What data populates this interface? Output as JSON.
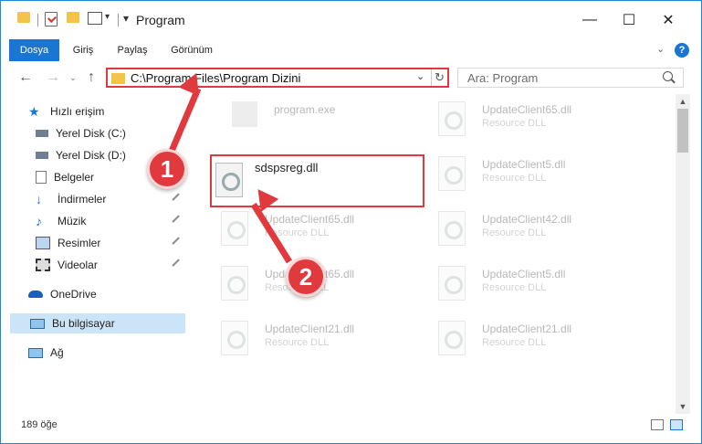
{
  "window": {
    "title": "Program"
  },
  "ribbon": {
    "tabs": [
      "Dosya",
      "Giriş",
      "Paylaş",
      "Görünüm"
    ]
  },
  "address": {
    "path": "C:\\Program Files\\Program Dizini"
  },
  "search": {
    "placeholder": "Ara: Program"
  },
  "sidebar": {
    "items": [
      {
        "label": "Hızlı erişim"
      },
      {
        "label": "Yerel Disk (C:)"
      },
      {
        "label": "Yerel Disk (D:)"
      },
      {
        "label": "Belgeler"
      },
      {
        "label": "İndirmeler"
      },
      {
        "label": "Müzik"
      },
      {
        "label": "Resimler"
      },
      {
        "label": "Videolar"
      },
      {
        "label": "OneDrive"
      },
      {
        "label": "Bu bilgisayar"
      },
      {
        "label": "Ağ"
      }
    ]
  },
  "files": [
    {
      "name": "program.exe",
      "desc": ""
    },
    {
      "name": "UpdateClient65.dll",
      "desc": "Resource DLL"
    },
    {
      "name": "sdspsreg.dll",
      "desc": ""
    },
    {
      "name": "UpdateClient5.dll",
      "desc": "Resource DLL"
    },
    {
      "name": "UpdateClient65.dll",
      "desc": "Resource DLL"
    },
    {
      "name": "UpdateClient42.dll",
      "desc": "Resource DLL"
    },
    {
      "name": "UpdateClient65.dll",
      "desc": "Resource DLL"
    },
    {
      "name": "UpdateClient5.dll",
      "desc": "Resource DLL"
    },
    {
      "name": "UpdateClient21.dll",
      "desc": "Resource DLL"
    },
    {
      "name": "UpdateClient21.dll",
      "desc": "Resource DLL"
    }
  ],
  "status": {
    "count": "189 öğe"
  },
  "annotations": {
    "step1": "1",
    "step2": "2"
  },
  "colors": {
    "accent": "#1976d2",
    "highlight": "#e0393e"
  }
}
